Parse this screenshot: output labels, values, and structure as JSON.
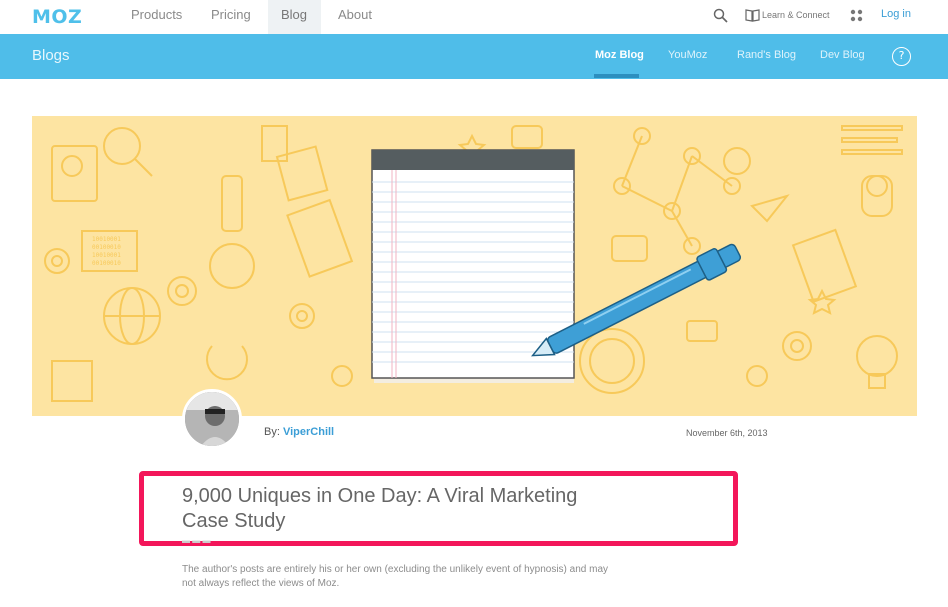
{
  "brand": {
    "logo": "MOZ"
  },
  "topnav": {
    "items": [
      {
        "label": "Products"
      },
      {
        "label": "Pricing"
      },
      {
        "label": "Blog"
      },
      {
        "label": "About"
      }
    ],
    "learn_label": "Learn & Connect",
    "login_label": "Log in"
  },
  "subnav": {
    "title": "Blogs",
    "items": [
      {
        "label": "Moz Blog"
      },
      {
        "label": "YouMoz"
      },
      {
        "label": "Rand's Blog"
      },
      {
        "label": "Dev Blog"
      }
    ],
    "help_label": "?"
  },
  "post": {
    "by_label": "By:",
    "author": "ViperChill",
    "date": "November 6th, 2013",
    "title": "9,000 Uniques in One Day: A Viral Marketing Case Study",
    "disclaimer": "The author's posts are entirely his or her own (excluding the unlikely event of hypnosis) and may not always reflect the views of Moz."
  },
  "colors": {
    "brand_blue": "#4fbde9",
    "hero_yellow": "#fde4a2",
    "highlight": "#f3165a",
    "link": "#3b9ed6"
  }
}
